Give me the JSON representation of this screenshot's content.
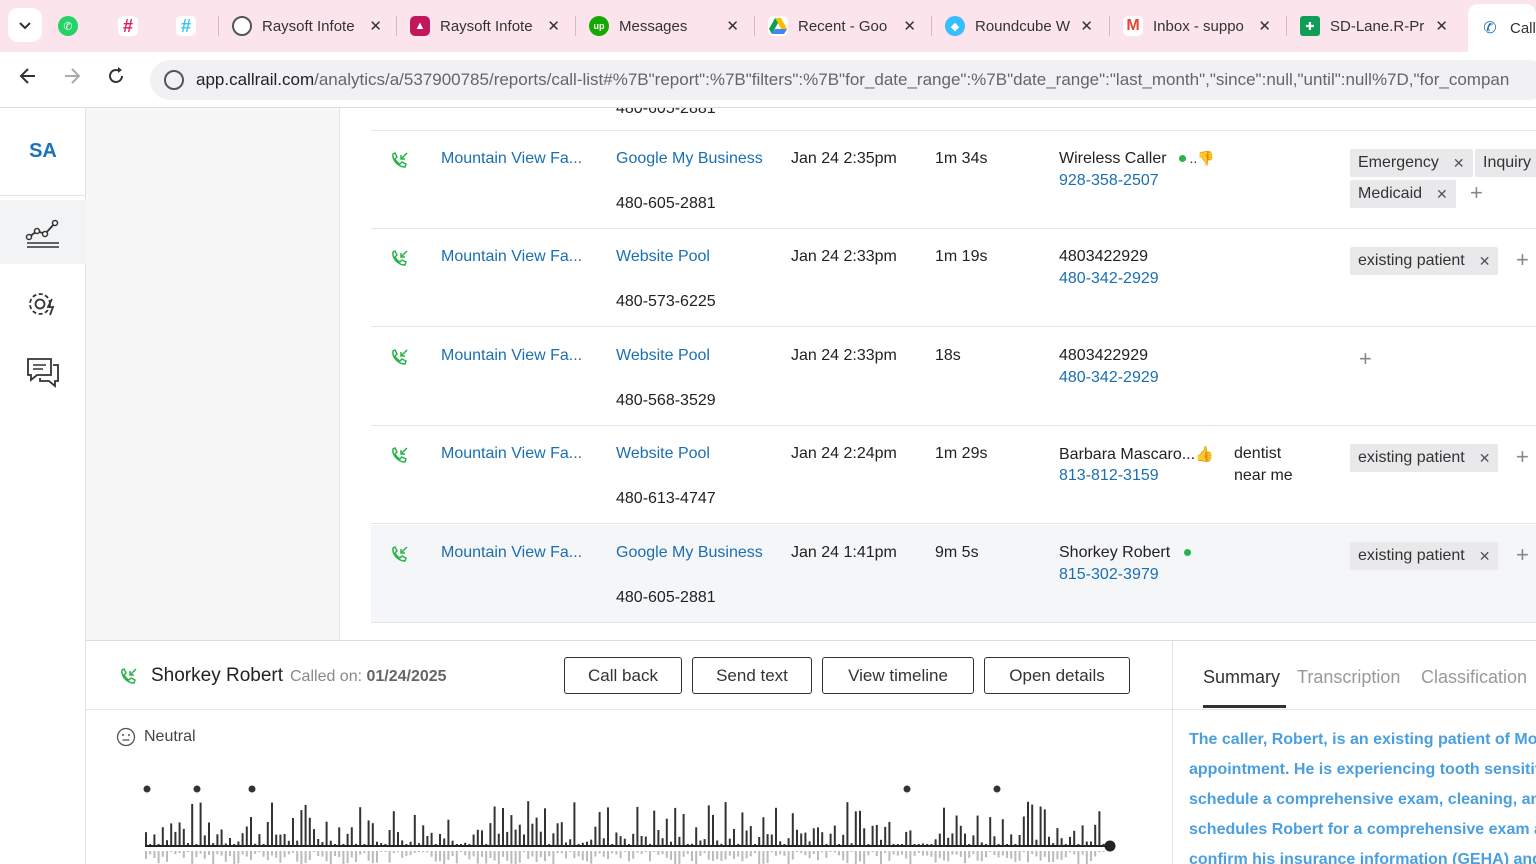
{
  "browser": {
    "tabs": [
      {
        "title": "",
        "icon": "whatsapp-icon",
        "color": "#25D366"
      },
      {
        "title": "",
        "icon": "slack-icon",
        "color": "#e01e5a"
      },
      {
        "title": "",
        "icon": "slack-icon",
        "color": "#36c5f0"
      },
      {
        "title": "Raysoft Infote",
        "icon": "globe-icon",
        "color": "#555555"
      },
      {
        "title": "Raysoft Infote",
        "icon": "graduation-icon",
        "color": "#c2185b"
      },
      {
        "title": "Messages",
        "icon": "upwork-icon",
        "color": "#14a800"
      },
      {
        "title": "Recent - Goo",
        "icon": "google-drive-icon",
        "color": "#fbbc04"
      },
      {
        "title": "Roundcube W",
        "icon": "roundcube-icon",
        "color": "#37beff"
      },
      {
        "title": "Inbox - suppo",
        "icon": "gmail-icon",
        "color": "#ea4335"
      },
      {
        "title": "SD-Lane.R-Pr",
        "icon": "sheets-icon",
        "color": "#0f9d58"
      },
      {
        "title": "Call",
        "icon": "phone-icon",
        "color": "#1a6fb3"
      }
    ],
    "url_host": "app.callrail.com",
    "url_path": "/analytics/a/537900785/reports/call-list#%7B\"report\":%7B\"filters\":%7B\"for_date_range\":%7B\"date_range\":\"last_month\",\"since\":null,\"until\":null%7D,\"for_compan"
  },
  "rail": {
    "logo": "SA",
    "items": [
      "analytics-icon",
      "settings-icon",
      "conversations-icon"
    ]
  },
  "table": {
    "partial_top_number": "480-605-2881",
    "rows": [
      {
        "company": "Mountain View Fa...",
        "source": "Google My Business",
        "tracking": "480-605-2881",
        "time": "Jan 24 2:35pm",
        "duration": "1m 34s",
        "caller": "Wireless Caller",
        "caller_phone": "928-358-2507",
        "keywords": "",
        "tags": [
          "Emergency",
          "Inquiry",
          "Medicaid"
        ]
      },
      {
        "company": "Mountain View Fa...",
        "source": "Website Pool",
        "tracking": "480-573-6225",
        "time": "Jan 24 2:33pm",
        "duration": "1m 19s",
        "caller": "4803422929",
        "caller_phone": "480-342-2929",
        "keywords": "",
        "tags": [
          "existing patient"
        ]
      },
      {
        "company": "Mountain View Fa...",
        "source": "Website Pool",
        "tracking": "480-568-3529",
        "time": "Jan 24 2:33pm",
        "duration": "18s",
        "caller": "4803422929",
        "caller_phone": "480-342-2929",
        "keywords": "",
        "tags": []
      },
      {
        "company": "Mountain View Fa...",
        "source": "Website Pool",
        "tracking": "480-613-4747",
        "time": "Jan 24 2:24pm",
        "duration": "1m 29s",
        "caller": "Barbara Mascaro...",
        "caller_phone": "813-812-3159",
        "keywords": "dentist near me",
        "keywords_line1": "dentist",
        "keywords_line2": "near me",
        "tags": [
          "existing patient"
        ]
      },
      {
        "company": "Mountain View Fa...",
        "source": "Google My Business",
        "tracking": "480-605-2881",
        "time": "Jan 24 1:41pm",
        "duration": "9m 5s",
        "caller": "Shorkey Robert",
        "caller_phone": "815-302-3979",
        "keywords": "",
        "tags": [
          "existing patient"
        ]
      }
    ]
  },
  "detail": {
    "caller_name": "Shorkey Robert",
    "called_on_label": "Called on:",
    "called_on_date": "01/24/2025",
    "buttons": {
      "call_back": "Call back",
      "send_text": "Send text",
      "view_timeline": "View timeline",
      "open_details": "Open details"
    },
    "sentiment": "Neutral",
    "tabs": {
      "summary": "Summary",
      "transcription": "Transcription",
      "classification": "Classification"
    },
    "summary_lines": [
      "The caller, Robert, is an existing patient of Mou",
      "appointment. He is experiencing tooth sensitiv",
      "schedule a comprehensive exam, cleaning, and",
      "schedules Robert for a comprehensive exam ar",
      "confirm his insurance information (GEHA) and"
    ]
  },
  "colors": {
    "link": "#1a6fb3",
    "accent_green": "#29b34a",
    "summary_blue": "#4a9fe0",
    "tabbar_bg": "#fbe4ec"
  }
}
